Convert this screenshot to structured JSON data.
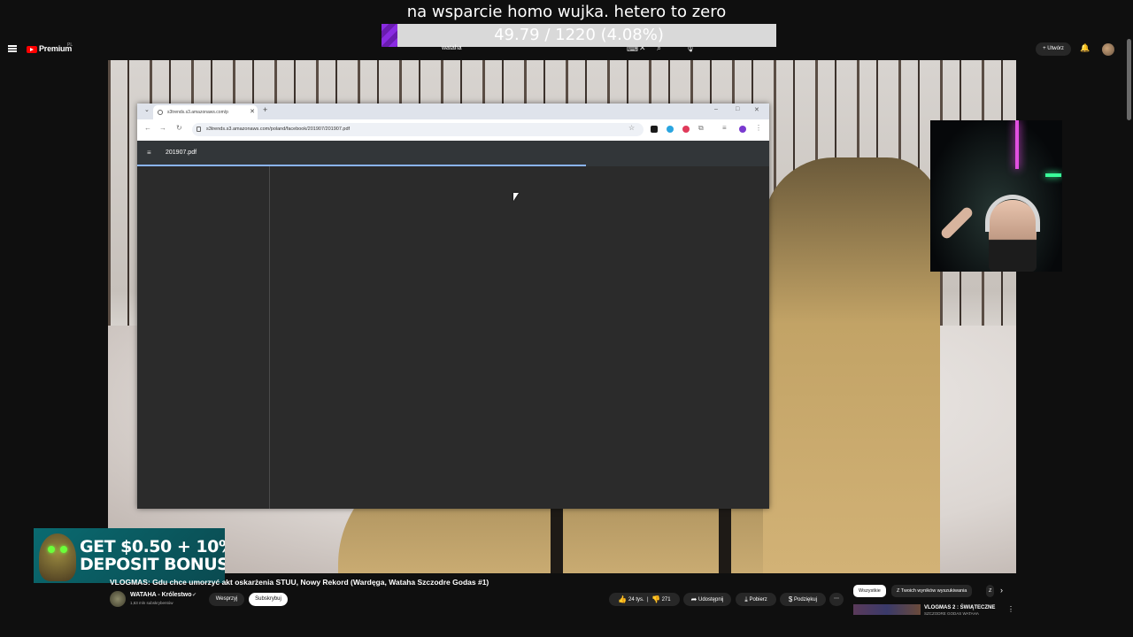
{
  "overlay": {
    "banner": "na wsparcie homo wujka. hetero to zero",
    "goal_text": "49.79 / 1220 (4.08%)",
    "goal_progress": 0.0408
  },
  "yt_header": {
    "logo": "Premium",
    "logo_sup": "PL",
    "search_query": "wataha",
    "create_label": "Utwórz"
  },
  "browser": {
    "tab_title": "s3trends.s3.amazonaws.com/p",
    "url": "s3trends.s3.amazonaws.com/poland/facebook/201907/201907.pdf",
    "pdf_title": "201907.pdf",
    "load_progress": 0.71
  },
  "ad": {
    "line1": "GET $0.50 + 10%",
    "line2": "DEPOSIT BONUS"
  },
  "video": {
    "title": "VLOGMAS: Gdu chce umorzyć akt oskarżenia STUU, Nowy Rekord (Wardęga, Wataha Szczodre Godas #1)",
    "channel": "WATAHA - Królestwo",
    "subs": "1,63 mln subskrybentów",
    "join_label": "Wesprzyj",
    "subscribe_label": "Subskrybuj",
    "likes": "24 tys.",
    "dislikes": "271",
    "share_label": "Udostępnij",
    "download_label": "Pobierz",
    "thanks_label": "Podziękuj"
  },
  "chips": [
    "Wszystkie",
    "Z Twoich wyników wyszukiwania",
    "Z"
  ],
  "related": {
    "title": "VLOGMAS 2 : ŚWIĄTECZNE",
    "sub": "SZCZODRE GODAS WATAHA"
  }
}
